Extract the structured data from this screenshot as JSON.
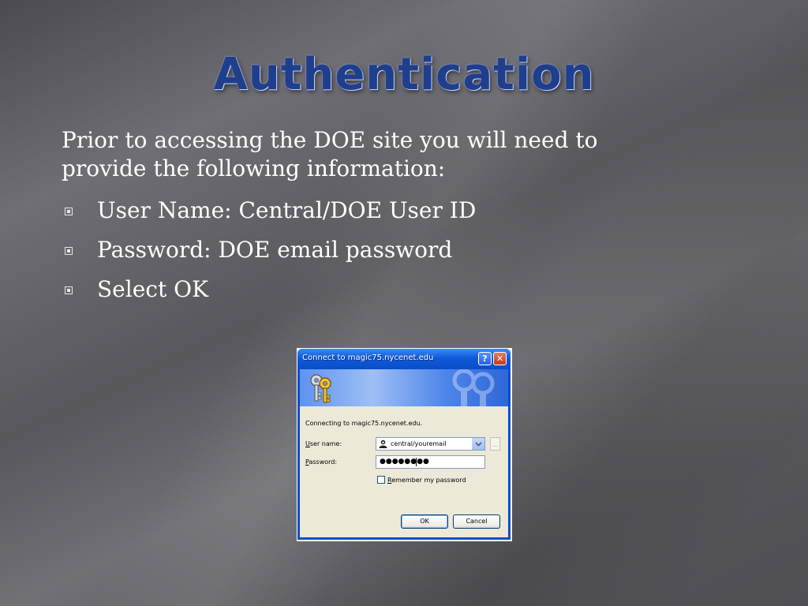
{
  "slide": {
    "title": "Authentication",
    "intro": "Prior to accessing the DOE site you will need to provide the following information:",
    "bullets": [
      {
        "text": "User Name: Central/DOE User ID"
      },
      {
        "text": "Password: DOE email password"
      },
      {
        "text": "Select OK"
      }
    ]
  },
  "dialog": {
    "title": "Connect to magic75.nycenet.edu",
    "help_glyph": "?",
    "close_glyph": "✕",
    "connecting": "Connecting to magic75.nycenet.edu.",
    "user_label_accel": "U",
    "user_label_rest": "ser name:",
    "user_value": "central/youremail",
    "browse_glyph": "...",
    "pass_label_accel": "P",
    "pass_label_rest": "assword:",
    "pass_mask": "●●●●●●●●",
    "remember_accel": "R",
    "remember_rest": "emember my password",
    "remember_checked": false,
    "ok_label": "OK",
    "cancel_label": "Cancel",
    "icons": [
      "keys-icon",
      "user-icon",
      "dropdown-arrow-icon"
    ],
    "colors": {
      "titlebar": "#0a4ec8",
      "client": "#ece9d8",
      "close": "#c33a1c"
    }
  },
  "theme": {
    "title_color": "#1f3e8c",
    "text_color": "#ffffff"
  }
}
